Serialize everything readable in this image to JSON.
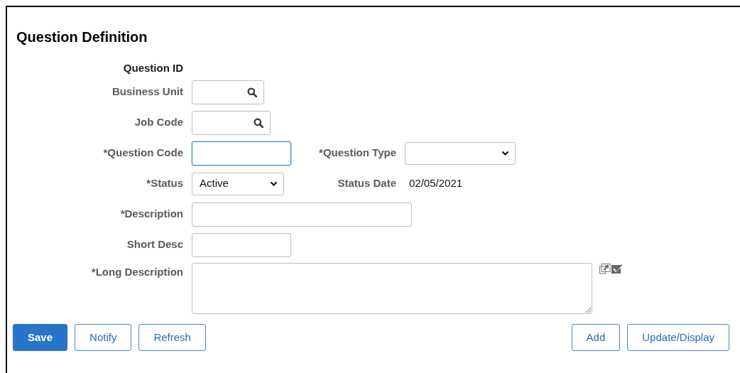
{
  "title": "Question Definition",
  "question_id": {
    "label": "Question ID"
  },
  "rows": [
    {
      "kind": "lookup",
      "label": "Business Unit",
      "focused": false
    },
    {
      "kind": "lookup",
      "label": "Job Code",
      "focused": false
    },
    {
      "kind": "text",
      "label": "*Question Code",
      "focused": true,
      "side": {
        "kind": "select",
        "label": "*Question Type"
      }
    },
    {
      "kind": "select",
      "label": "*Status",
      "value": "Active",
      "focused": false,
      "side": {
        "kind": "display",
        "label": "Status Date",
        "value": "02/05/2021"
      }
    },
    {
      "kind": "text",
      "label": "*Description",
      "focused": false
    },
    {
      "kind": "text",
      "label": "Short Desc",
      "focused": false
    },
    {
      "kind": "textarea",
      "label": "*Long Description",
      "focused": false
    }
  ],
  "buttons_left": [
    {
      "label": "Save",
      "kind": "primary"
    },
    {
      "label": "Notify",
      "kind": "secondary"
    },
    {
      "label": "Refresh",
      "kind": "secondary"
    }
  ],
  "buttons_right": [
    {
      "label": "Add",
      "kind": "secondary"
    },
    {
      "label": "Update/Display",
      "kind": "secondary"
    }
  ]
}
